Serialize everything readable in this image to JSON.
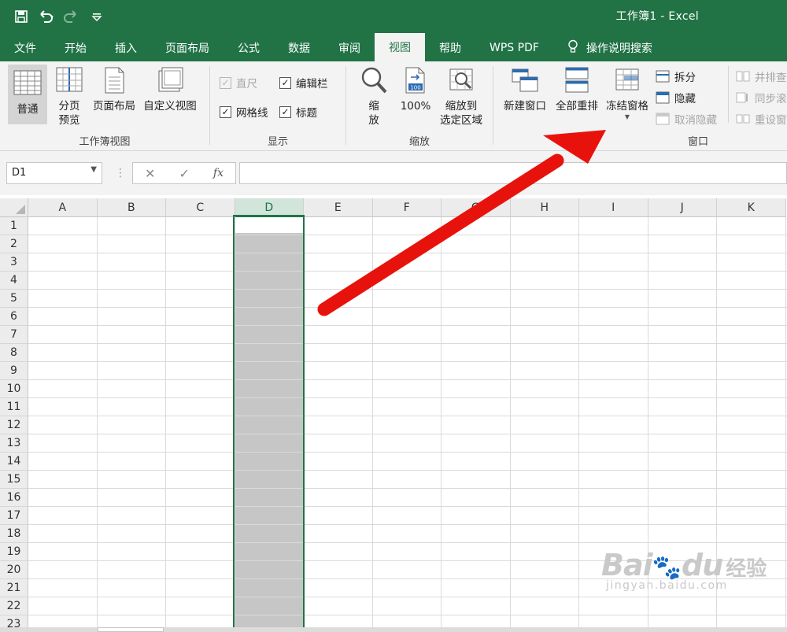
{
  "window": {
    "title": "工作簿1  -  Excel"
  },
  "qat": {
    "save": "save-icon",
    "undo": "undo-icon",
    "redo": "redo-icon",
    "customize": "customize-icon"
  },
  "tabs": [
    {
      "label": "文件"
    },
    {
      "label": "开始"
    },
    {
      "label": "插入"
    },
    {
      "label": "页面布局"
    },
    {
      "label": "公式"
    },
    {
      "label": "数据"
    },
    {
      "label": "审阅"
    },
    {
      "label": "视图"
    },
    {
      "label": "帮助"
    },
    {
      "label": "WPS PDF"
    },
    {
      "label": "操作说明搜索"
    }
  ],
  "ribbon": {
    "workbook_views": {
      "label": "工作簿视图",
      "normal": "普通",
      "page_break_line1": "分页",
      "page_break_line2": "预览",
      "page_layout": "页面布局",
      "custom_views": "自定义视图"
    },
    "show": {
      "label": "显示",
      "ruler": "直尺",
      "formula_bar": "编辑栏",
      "gridlines": "网格线",
      "headings": "标题"
    },
    "zoom": {
      "label": "缩放",
      "zoom_line1": "缩",
      "zoom_line2": "放",
      "zoom100": "100%",
      "zoom_sel_line1": "缩放到",
      "zoom_sel_line2": "选定区域",
      "icon_100": "100"
    },
    "window": {
      "label": "窗口",
      "new_window": "新建窗口",
      "arrange_all": "全部重排",
      "freeze_panes": "冻结窗格",
      "split": "拆分",
      "hide": "隐藏",
      "unhide": "取消隐藏",
      "side_by_side": "并排查",
      "sync_scroll": "同步滚",
      "reset_pos": "重设窗"
    }
  },
  "formula_bar": {
    "name_box": "D1",
    "fx": "fx",
    "value": ""
  },
  "grid": {
    "columns": [
      "A",
      "B",
      "C",
      "D",
      "E",
      "F",
      "G",
      "H",
      "I",
      "J",
      "K"
    ],
    "rows": [
      "1",
      "2",
      "3",
      "4",
      "5",
      "6",
      "7",
      "8",
      "9",
      "10",
      "11",
      "12",
      "13",
      "14",
      "15",
      "16",
      "17",
      "18",
      "19",
      "20",
      "21",
      "22",
      "23"
    ],
    "selected_column": "D"
  },
  "watermark": {
    "logo": "Bai",
    "logo2": "du",
    "cn": "经验",
    "url": "jingyan.baidu.com"
  },
  "colors": {
    "accent": "#217346",
    "arrow": "#e8120c"
  }
}
